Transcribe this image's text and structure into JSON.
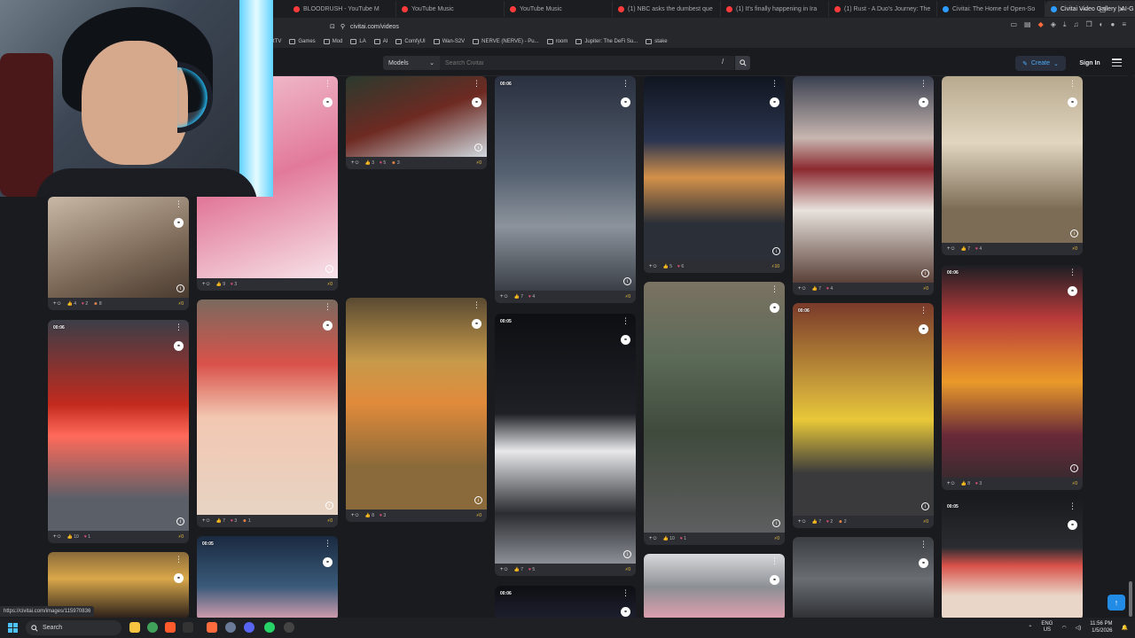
{
  "browser": {
    "tabs": [
      {
        "title": "BLOODRUSH - YouTube M",
        "color": "#ff3b3b",
        "active": false
      },
      {
        "title": "YouTube Music",
        "color": "#ff3b3b",
        "active": false
      },
      {
        "title": "YouTube Music",
        "color": "#ff3b3b",
        "active": false
      },
      {
        "title": "(1) NBC asks the dumbest que",
        "color": "#ff3b3b",
        "active": false
      },
      {
        "title": "(1) It's finally happening in Ira",
        "color": "#ff3b3b",
        "active": false
      },
      {
        "title": "(1) Rust - A Duo's Journey: The",
        "color": "#ff3b3b",
        "active": false
      },
      {
        "title": "Civitai: The Home of Open-So",
        "color": "#2f9cff",
        "active": false
      },
      {
        "title": "Civitai Video Gallery | AI-G",
        "color": "#2f9cff",
        "active": true
      }
    ],
    "url": "civitai.com/videos",
    "bookmarks": [
      "tTV",
      "Games",
      "Mod",
      "LA",
      "AI",
      "ComfyUI",
      "Wan-S2V",
      "NERVE (NERVE) - Pu...",
      "room",
      "Jupiter: The DeFi Su...",
      "stake"
    ]
  },
  "site": {
    "models_label": "Models",
    "search_placeholder": "Search Civitai",
    "slash_key": "/",
    "create_label": "Create",
    "signin_label": "Sign In"
  },
  "cards": [
    {
      "dur": "",
      "stats": [
        "4",
        "2",
        "8"
      ],
      "buzz": "0"
    },
    {
      "dur": "",
      "stats": [
        "9",
        "3",
        ""
      ],
      "buzz": "0"
    },
    {
      "dur": "",
      "stats": [
        "3",
        "5",
        "3"
      ],
      "buzz": "0"
    },
    {
      "dur": "00:06",
      "stats": [
        "7",
        "4",
        ""
      ],
      "buzz": "0"
    },
    {
      "dur": "",
      "stats": [
        "5",
        "6",
        ""
      ],
      "buzz": "10"
    },
    {
      "dur": "",
      "stats": [
        "7",
        "4",
        ""
      ],
      "buzz": "0"
    },
    {
      "dur": "",
      "stats": [
        "7",
        "4",
        ""
      ],
      "buzz": "0"
    },
    {
      "dur": "00:06",
      "stats": [
        "10",
        "1",
        ""
      ],
      "buzz": "0"
    },
    {
      "dur": "",
      "stats": [
        "7",
        "3",
        "1"
      ],
      "buzz": "0"
    },
    {
      "dur": "",
      "stats": [
        "8",
        "3",
        ""
      ],
      "buzz": "0"
    },
    {
      "dur": "00:05",
      "stats": [
        "7",
        "5",
        ""
      ],
      "buzz": "0"
    },
    {
      "dur": "",
      "stats": [
        "10",
        "1",
        ""
      ],
      "buzz": "0"
    },
    {
      "dur": "00:06",
      "stats": [
        "7",
        "2",
        "2"
      ],
      "buzz": "0"
    },
    {
      "dur": "00:06",
      "stats": [
        "8",
        "3",
        ""
      ],
      "buzz": "0"
    },
    {
      "dur": "",
      "stats": [
        "",
        "",
        ""
      ],
      "buzz": ""
    },
    {
      "dur": "00:05",
      "stats": [
        "",
        "",
        ""
      ],
      "buzz": ""
    },
    {
      "dur": "00:06",
      "stats": [
        "",
        "",
        ""
      ],
      "buzz": ""
    },
    {
      "dur": "",
      "stats": [
        "",
        "",
        ""
      ],
      "buzz": ""
    },
    {
      "dur": "",
      "stats": [
        "",
        "",
        ""
      ],
      "buzz": ""
    },
    {
      "dur": "00:05",
      "stats": [
        "",
        "",
        ""
      ],
      "buzz": ""
    }
  ],
  "status_url": "https://civitai.com/images/115970836",
  "taskbar": {
    "search_label": "Search",
    "lang": "ENG",
    "region": "US",
    "time": "11:56 PM",
    "date": "1/5/2026"
  }
}
